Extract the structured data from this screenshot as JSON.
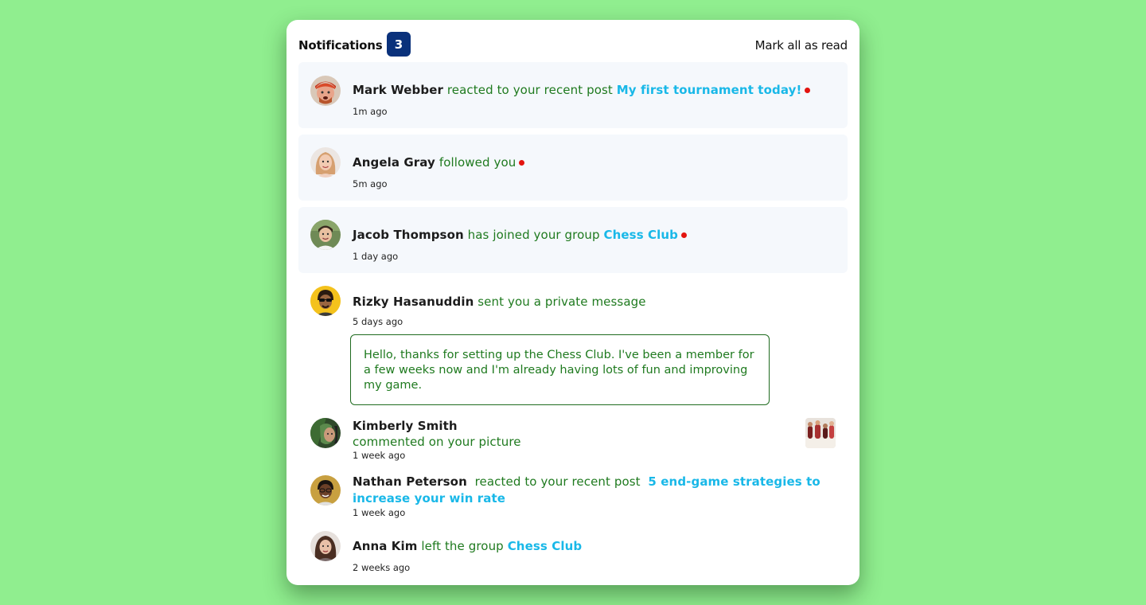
{
  "header": {
    "title": "Notifications",
    "unread_count": "3",
    "mark_all_label": "Mark all as read"
  },
  "notifications": [
    {
      "name": "Mark Webber",
      "action": "reacted to your recent post",
      "target": "My first tournament today!",
      "time": "1m ago",
      "unread": true
    },
    {
      "name": "Angela Gray",
      "action": "followed you",
      "time": "5m ago",
      "unread": true
    },
    {
      "name": "Jacob Thompson",
      "action": "has joined your group",
      "target": "Chess Club",
      "time": "1 day ago",
      "unread": true
    },
    {
      "name": "Rizky Hasanuddin",
      "action": "sent you a private message",
      "time": "5 days ago",
      "message": "Hello, thanks for setting up the Chess Club. I've been a member for a few weeks now and I'm already having lots of fun and improving my game.",
      "unread": false
    },
    {
      "name": "Kimberly Smith",
      "action": "commented on your picture",
      "time": "1 week ago",
      "unread": false
    },
    {
      "name": "Nathan Peterson",
      "action": "reacted to your recent post",
      "target": "5 end-game strategies to increase your win rate",
      "time": "1 week ago",
      "unread": false
    },
    {
      "name": "Anna Kim",
      "action": "left the group",
      "target": "Chess Club",
      "time": "2 weeks ago",
      "unread": false
    }
  ],
  "colors": {
    "background": "#90ee8f",
    "badge": "#0a317b",
    "action_text": "#1f7a1f",
    "link": "#19b8e8",
    "unread_dot": "#e3140f",
    "unread_bg": "#f5f8fc"
  },
  "icons": {
    "unread_indicator": "red-dot-icon"
  }
}
